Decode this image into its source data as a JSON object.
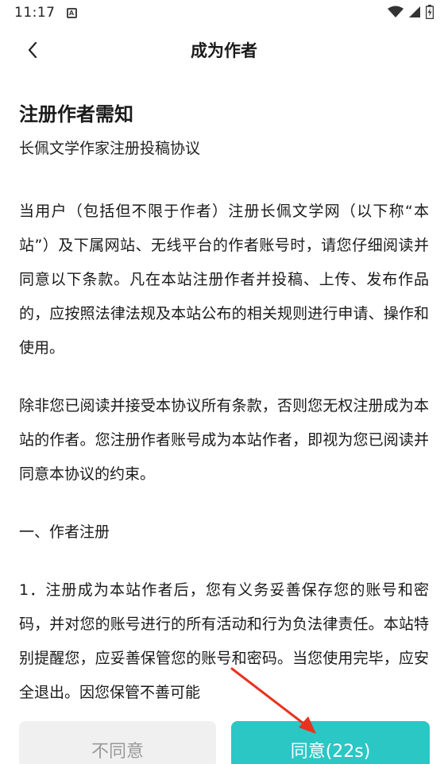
{
  "status_bar": {
    "time": "11:17",
    "notif_glyph": "A"
  },
  "header": {
    "title": "成为作者"
  },
  "document": {
    "heading": "注册作者需知",
    "subtitle": "长佩文学作家注册投稿协议",
    "paragraphs": [
      "当用户（包括但不限于作者）注册长佩文学网（以下称“本站”）及下属网站、无线平台的作者账号时，请您仔细阅读并同意以下条款。凡在本站注册作者并投稿、上传、发布作品的，应按照法律法规及本站公布的相关规则进行申请、操作和使用。",
      "除非您已阅读并接受本协议所有条款，否则您无权注册成为本站的作者。您注册作者账号成为本站作者，即视为您已阅读并同意本协议的约束。",
      "一、作者注册",
      "1．注册成为本站作者后，您有义务妥善保存您的账号和密码，并对您的账号进行的所有活动和行为负法律责任。本站特别提醒您，应妥善保管您的账号和密码。当您使用完毕，应安全退出。因您保管不善可能"
    ]
  },
  "footer": {
    "disagree_label": "不同意",
    "agree_label": "同意(22s)"
  },
  "colors": {
    "accent": "#2bc7c5",
    "disabled_bg": "#f0f0f0",
    "annotation_arrow": "#e8321e"
  },
  "icons": [
    "back-chevron-icon",
    "wifi-icon",
    "signal-icon",
    "battery-icon"
  ]
}
